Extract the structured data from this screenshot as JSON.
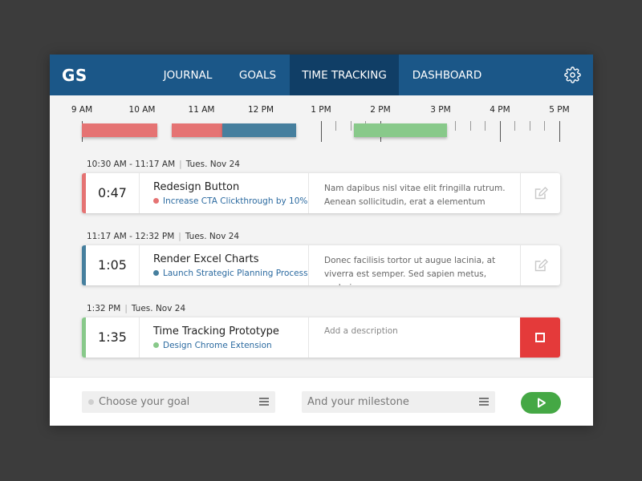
{
  "header": {
    "logo": "GS",
    "tabs": [
      {
        "label": "JOURNAL",
        "active": false
      },
      {
        "label": "GOALS",
        "active": false
      },
      {
        "label": "TIME TRACKING",
        "active": true
      },
      {
        "label": "DASHBOARD",
        "active": false
      }
    ],
    "settings_icon": "gear-icon"
  },
  "timeline": {
    "hours": [
      "9 AM",
      "10 AM",
      "11 AM",
      "12 PM",
      "1 PM",
      "2 PM",
      "3 PM",
      "4 PM",
      "5 PM"
    ],
    "segments": [
      {
        "start": "9:00",
        "end": "10:15",
        "color": "#e57373"
      },
      {
        "start": "10:30",
        "end": "11:17",
        "color": "#e57373"
      },
      {
        "start": "11:17",
        "end": "12:32",
        "color": "#467f9e"
      },
      {
        "start": "1:32",
        "end": "3:07",
        "color": "#88c98a"
      }
    ]
  },
  "entries": [
    {
      "time_range": "10:30 AM - 11:17 AM",
      "date": "Tues. Nov 24",
      "duration": "0:47",
      "task": "Redesign Button",
      "goal": "Increase CTA Clickthrough by 10%",
      "color": "#e57373",
      "description": "Nam dapibus nisl vitae elit fringilla rutrum. Aenean sollicitudin, erat a elementum neque.",
      "action_icon": "edit-icon"
    },
    {
      "time_range": "11:17 AM - 12:32 PM",
      "date": "Tues. Nov 24",
      "duration": "1:05",
      "task": "Render Excel Charts",
      "goal": "Launch Strategic Planning Process",
      "color": "#467f9e",
      "description": "Donec facilisis tortor ut augue lacinia, at viverra est semper. Sed sapien metus, scelerisque nec.",
      "action_icon": "edit-icon"
    },
    {
      "time_range": "1:32 PM",
      "date": "Tues. Nov 24",
      "duration": "1:35",
      "task": "Time Tracking Prototype",
      "goal": "Design Chrome Extension",
      "color": "#88c98a",
      "description_placeholder": "Add a description",
      "action_icon": "stop-icon",
      "action_color": "#e43a3a"
    }
  ],
  "footer": {
    "goal_placeholder": "Choose your goal",
    "milestone_placeholder": "And your milestone",
    "play_icon": "play-icon",
    "play_color": "#45a845"
  }
}
